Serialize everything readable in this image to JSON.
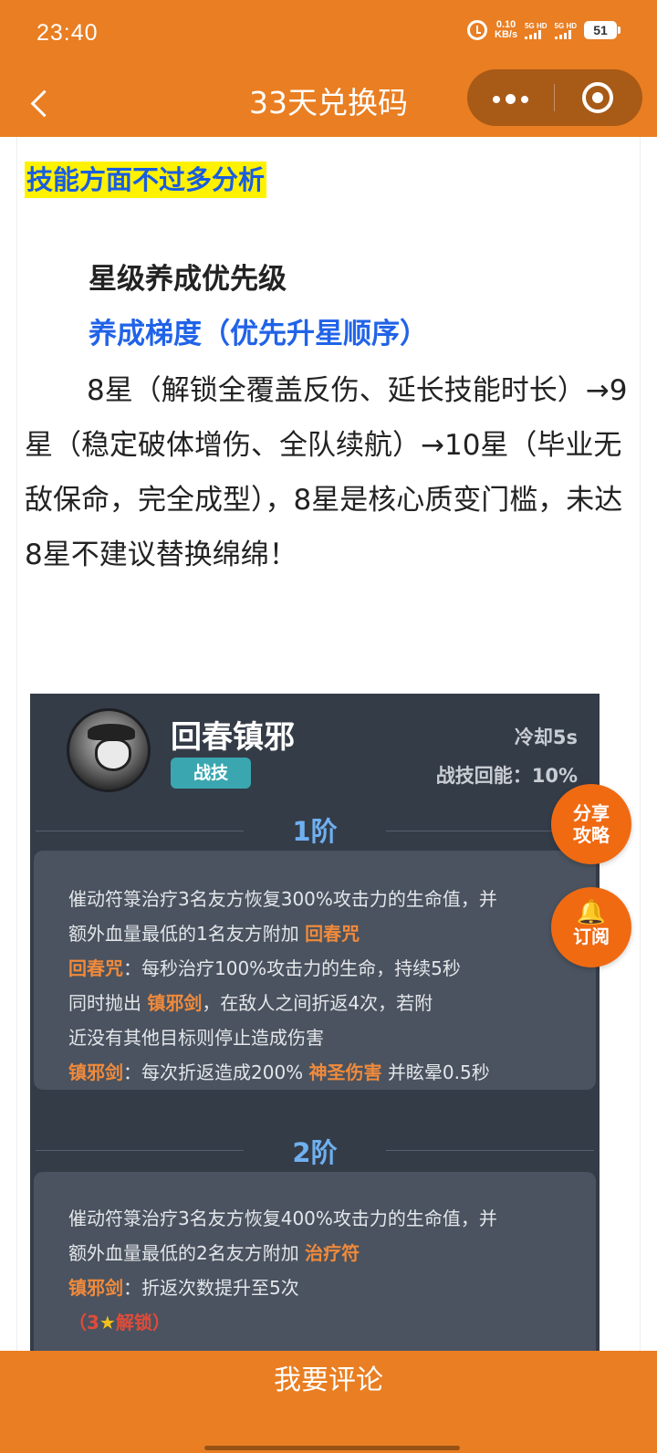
{
  "status_bar": {
    "time": "23:40",
    "net_speed_value": "0.10",
    "net_speed_unit": "KB/s",
    "sim1": "5G HD",
    "sim2": "5G HD",
    "battery": "51"
  },
  "nav": {
    "title": "33天兑换码",
    "back_icon": "chevron-left-icon",
    "more_icon": "more-dots-icon",
    "close_icon": "target-circle-icon"
  },
  "article": {
    "highlight_heading": "技能方面不过多分析",
    "sub_heading": "星级养成优先级",
    "blue_heading": "养成梯度（优先升星顺序）",
    "paragraph": "8星（解锁全覆盖反伤、延长技能时长）→9星（稳定破体增伤、全队续航）→10星（毕业无敌保命，完全成型），8星是核心质变门槛，未达8星不建议替换绵绵！"
  },
  "skill_card": {
    "name": "回春镇邪",
    "tag": "战技",
    "cooldown": "冷却5s",
    "energy": "战技回能：10%",
    "tier1": {
      "title": "1阶",
      "line1": "催动符箓治疗3名友方恢复300%攻击力的生命值，并",
      "line2_pre": "额外血量最低的1名友方附加 ",
      "line2_kw": "回春咒",
      "line3_kw": "回春咒",
      "line3_post": "：每秒治疗100%攻击力的生命，持续5秒",
      "line4_pre": "同时抛出 ",
      "line4_kw": "镇邪剑",
      "line4_post": "，在敌人之间折返4次，若附",
      "line5": "近没有其他目标则停止造成伤害",
      "line6_kw": "镇邪剑",
      "line6_mid": "：每次折返造成200% ",
      "line6_kw2": "神圣伤害",
      "line6_post": " 并眩晕0.5秒"
    },
    "tier2": {
      "title": "2阶",
      "line1": "催动符箓治疗3名友方恢复400%攻击力的生命值，并",
      "line2_pre": "额外血量最低的2名友方附加 ",
      "line2_kw": "治疗符",
      "line3_kw": "镇邪剑",
      "line3_post": "：折返次数提升至5次",
      "line4_pre": "（3",
      "line4_star": "★",
      "line4_post": "解锁）"
    }
  },
  "floating": {
    "share_label": "分享攻略",
    "share_l1": "分享",
    "share_l2": "攻略",
    "subscribe_icon": "bell-icon",
    "subscribe_label": "订阅"
  },
  "bottom": {
    "comment_label": "我要评论"
  },
  "colors": {
    "brand_orange": "#e97e22",
    "link_blue": "#2163e8",
    "highlight_yellow": "#fff200",
    "card_bg": "#343c48",
    "keyword_orange": "#f08a3c"
  }
}
